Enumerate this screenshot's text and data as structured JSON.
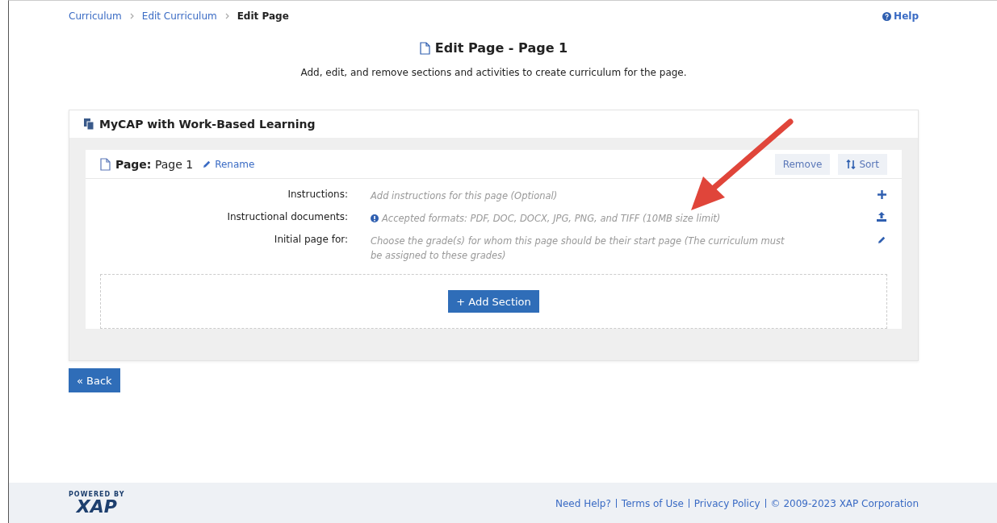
{
  "breadcrumb": [
    {
      "label": "Curriculum",
      "kind": "link"
    },
    {
      "label": "Edit Curriculum",
      "kind": "link"
    },
    {
      "label": "Edit Page",
      "kind": "current"
    }
  ],
  "help": "Help",
  "title": "Edit Page - Page 1",
  "subtitle": "Add, edit, and remove sections and activities to create curriculum for the page.",
  "curriculum": {
    "name": "MyCAP with Work-Based Learning"
  },
  "page": {
    "label": "Page:",
    "name": "Page 1",
    "rename": "Rename",
    "buttons": [
      {
        "label": "Remove",
        "kind": "remove"
      },
      {
        "label": "Sort",
        "kind": "sort"
      }
    ]
  },
  "fields": [
    {
      "label": "Instructions:",
      "hint": "Add instructions for this page (Optional)",
      "kind": "add",
      "info": false
    },
    {
      "label": "Instructional documents:",
      "hint": "Accepted formats: PDF, DOC, DOCX, JPG, PNG, and TIFF (10MB size limit)",
      "kind": "upload",
      "info": true
    },
    {
      "label": "Initial page for:",
      "hint": "Choose the grade(s) for whom this page should be their start page (The curriculum must be assigned to these grades)",
      "kind": "edit",
      "info": false
    }
  ],
  "add_section": "+ Add Section",
  "back": "« Back",
  "footer": {
    "powered_by": "POWERED BY",
    "logo": "XAP",
    "links": [
      "Need Help?",
      "Terms of Use",
      "Privacy Policy"
    ],
    "copyright": "© 2009-2023 XAP Corporation"
  }
}
